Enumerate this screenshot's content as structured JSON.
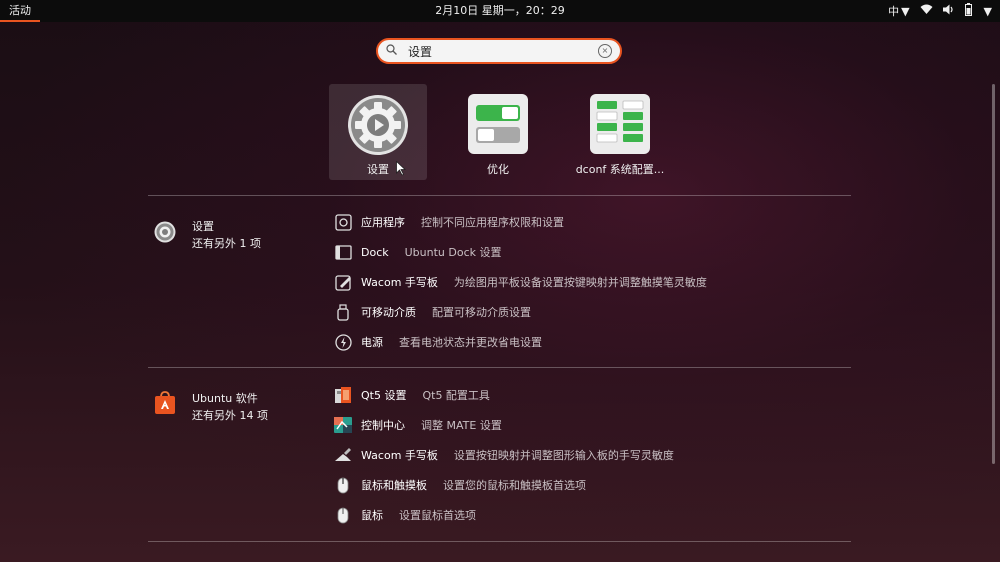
{
  "topbar": {
    "activities": "活动",
    "clock": "2月10日 星期一，20：29",
    "input_method": "中"
  },
  "search": {
    "value": "设置"
  },
  "apps": [
    {
      "label": "设置",
      "icon": "gear-icon"
    },
    {
      "label": "优化",
      "icon": "tweaks-toggle-icon"
    },
    {
      "label": "dconf 系统配置...",
      "icon": "dconf-icon"
    }
  ],
  "sections": [
    {
      "title": "设置",
      "subtitle": "还有另外 1 项",
      "icon": "settings-gear-icon",
      "results": [
        {
          "name": "应用程序",
          "desc": "控制不同应用程序权限和设置",
          "icon": "applications-icon"
        },
        {
          "name": "Dock",
          "desc": "Ubuntu Dock 设置",
          "icon": "dock-icon"
        },
        {
          "name": "Wacom 手写板",
          "desc": "为绘图用平板设备设置按键映射并调整触摸笔灵敏度",
          "icon": "wacom-tablet-icon"
        },
        {
          "name": "可移动介质",
          "desc": "配置可移动介质设置",
          "icon": "removable-media-icon"
        },
        {
          "name": "电源",
          "desc": "查看电池状态并更改省电设置",
          "icon": "power-icon"
        }
      ]
    },
    {
      "title": "Ubuntu 软件",
      "subtitle": "还有另外 14 项",
      "icon": "ubuntu-software-icon",
      "results": [
        {
          "name": "Qt5 设置",
          "desc": "Qt5 配置工具",
          "icon": "qt5-settings-icon"
        },
        {
          "name": "控制中心",
          "desc": "调整 MATE 设置",
          "icon": "control-center-icon"
        },
        {
          "name": "Wacom 手写板",
          "desc": "设置按钮映射并调整图形输入板的手写灵敏度",
          "icon": "wacom-pen-icon"
        },
        {
          "name": "鼠标和触摸板",
          "desc": "设置您的鼠标和触摸板首选项",
          "icon": "mouse-touchpad-icon"
        },
        {
          "name": "鼠标",
          "desc": "设置鼠标首选项",
          "icon": "mouse-icon"
        }
      ]
    }
  ],
  "colors": {
    "accent": "#e95420",
    "topbar": "#0c0c0c"
  }
}
